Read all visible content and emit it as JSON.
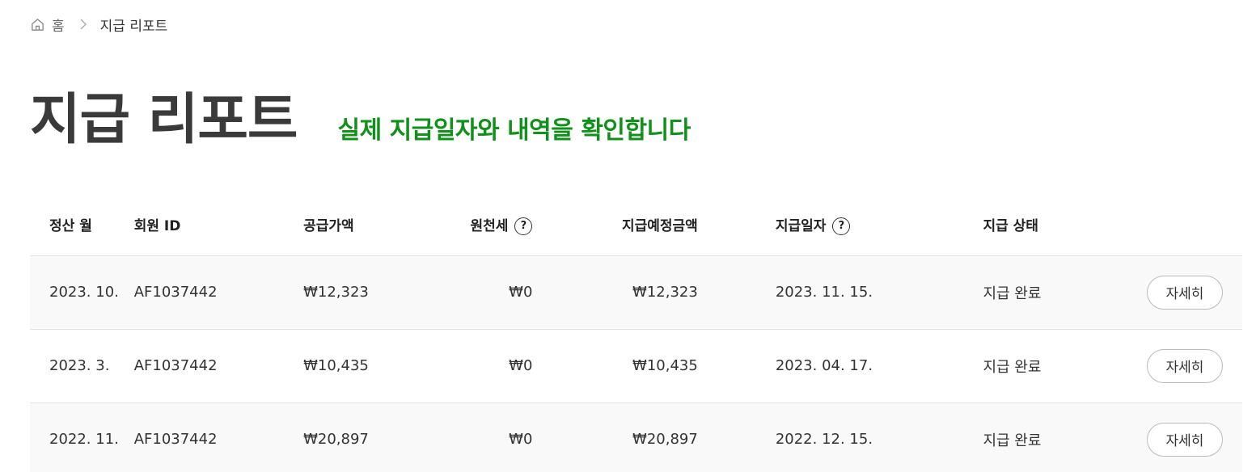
{
  "breadcrumb": {
    "home": "홈",
    "current": "지급 리포트"
  },
  "header": {
    "title": "지급 리포트",
    "subtitle": "실제 지급일자와 내역을 확인합니다"
  },
  "table": {
    "columns": {
      "month": "정산 월",
      "member_id": "회원 ID",
      "supply_amount": "공급가액",
      "withholding_tax": "원천세",
      "expected_amount": "지급예정금액",
      "payment_date": "지급일자",
      "status": "지급 상태"
    },
    "help_icon_glyph": "?",
    "rows": [
      {
        "month": "2023. 10.",
        "member_id": "AF1037442",
        "supply_amount": "₩12,323",
        "withholding_tax": "₩0",
        "expected_amount": "₩12,323",
        "payment_date": "2023. 11. 15.",
        "status": "지급 완료",
        "detail_label": "자세히"
      },
      {
        "month": "2023. 3.",
        "member_id": "AF1037442",
        "supply_amount": "₩10,435",
        "withholding_tax": "₩0",
        "expected_amount": "₩10,435",
        "payment_date": "2023. 04. 17.",
        "status": "지급 완료",
        "detail_label": "자세히"
      },
      {
        "month": "2022. 11.",
        "member_id": "AF1037442",
        "supply_amount": "₩20,897",
        "withholding_tax": "₩0",
        "expected_amount": "₩20,897",
        "payment_date": "2022. 12. 15.",
        "status": "지급 완료",
        "detail_label": "자세히"
      }
    ]
  },
  "colors": {
    "accent_green": "#11901b",
    "title_gray": "#3a3a3a",
    "row_stripe": "#f9f9f9"
  },
  "icons": {
    "home": "home-icon",
    "separator": "chevron-right-icon",
    "help": "help-circle-icon"
  }
}
